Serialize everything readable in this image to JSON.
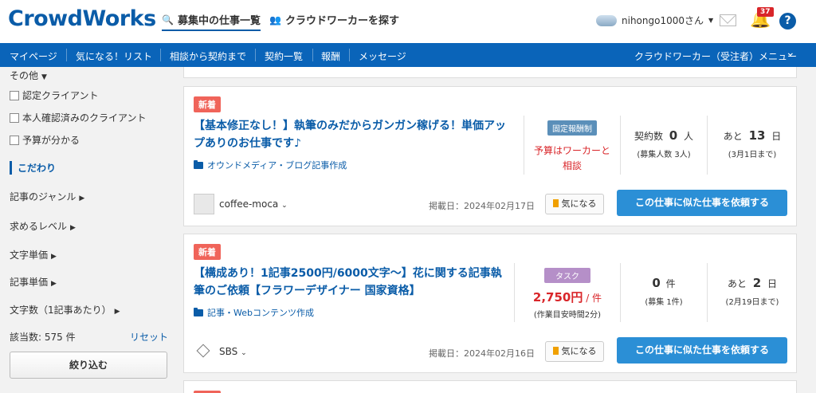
{
  "header": {
    "logo": "CrowdWorks",
    "nav_search": "募集中の仕事一覧",
    "nav_find": "クラウドワーカーを探す",
    "user_name": "nihongo1000さん",
    "notification_count": "37",
    "help": "?"
  },
  "bluebar": {
    "items": [
      "マイページ",
      "気になる！リスト",
      "相談から契約まで",
      "契約一覧",
      "報酬",
      "メッセージ"
    ],
    "menu": "クラウドワーカー（受注者）メニュー"
  },
  "sidebar": {
    "other": "その他",
    "checks": [
      "認定クライアント",
      "本人確認済みのクライアント",
      "予算が分かる"
    ],
    "kodawari": "こだわり",
    "filters": [
      "記事のジャンル",
      "求めるレベル",
      "文字単価",
      "記事単価",
      "文字数（1記事あたり）"
    ],
    "count": "該当数: 575 件",
    "reset": "リセット",
    "narrow": "絞り込む"
  },
  "jobs": [
    {
      "badge": "新着",
      "title": "【基本修正なし！】執筆のみだからガンガン稼げる！単価アップありのお仕事です♪",
      "category": "オウンドメディア・ブログ記事作成",
      "tag": "固定報酬制",
      "tag_color": "#5b8fb9",
      "price_line1": "予算はワーカーと",
      "price_line2": "相談",
      "contract_label": "契約数",
      "contract_value": "0",
      "contract_unit": "人",
      "contract_sub": "(募集人数 3人)",
      "remain_label": "あと",
      "remain_value": "13",
      "remain_unit": "日",
      "remain_sub": "(3月1日まで)",
      "client": "coffee-moca",
      "posted": "掲載日：2024年02月17日",
      "fav": "気になる",
      "request": "この仕事に似た仕事を依頼する"
    },
    {
      "badge": "新着",
      "title": "【構成あり！1記事2500円/6000文字〜】花に関する記事執筆のご依頼【フラワーデザイナー 国家資格】",
      "category": "記事・Webコンテンツ作成",
      "tag": "タスク",
      "tag_color": "#b58fc8",
      "price": "2,750円",
      "price_unit": "/ 件",
      "price_sub": "(作業目安時間2分)",
      "contract_value": "0",
      "contract_unit": "件",
      "contract_sub": "(募集 1件)",
      "remain_label": "あと",
      "remain_value": "2",
      "remain_unit": "日",
      "remain_sub": "(2月19日まで)",
      "client": "SBS",
      "posted": "掲載日：2024年02月16日",
      "fav": "気になる",
      "request": "この仕事に似た仕事を依頼する"
    },
    {
      "badge": "新着"
    }
  ]
}
